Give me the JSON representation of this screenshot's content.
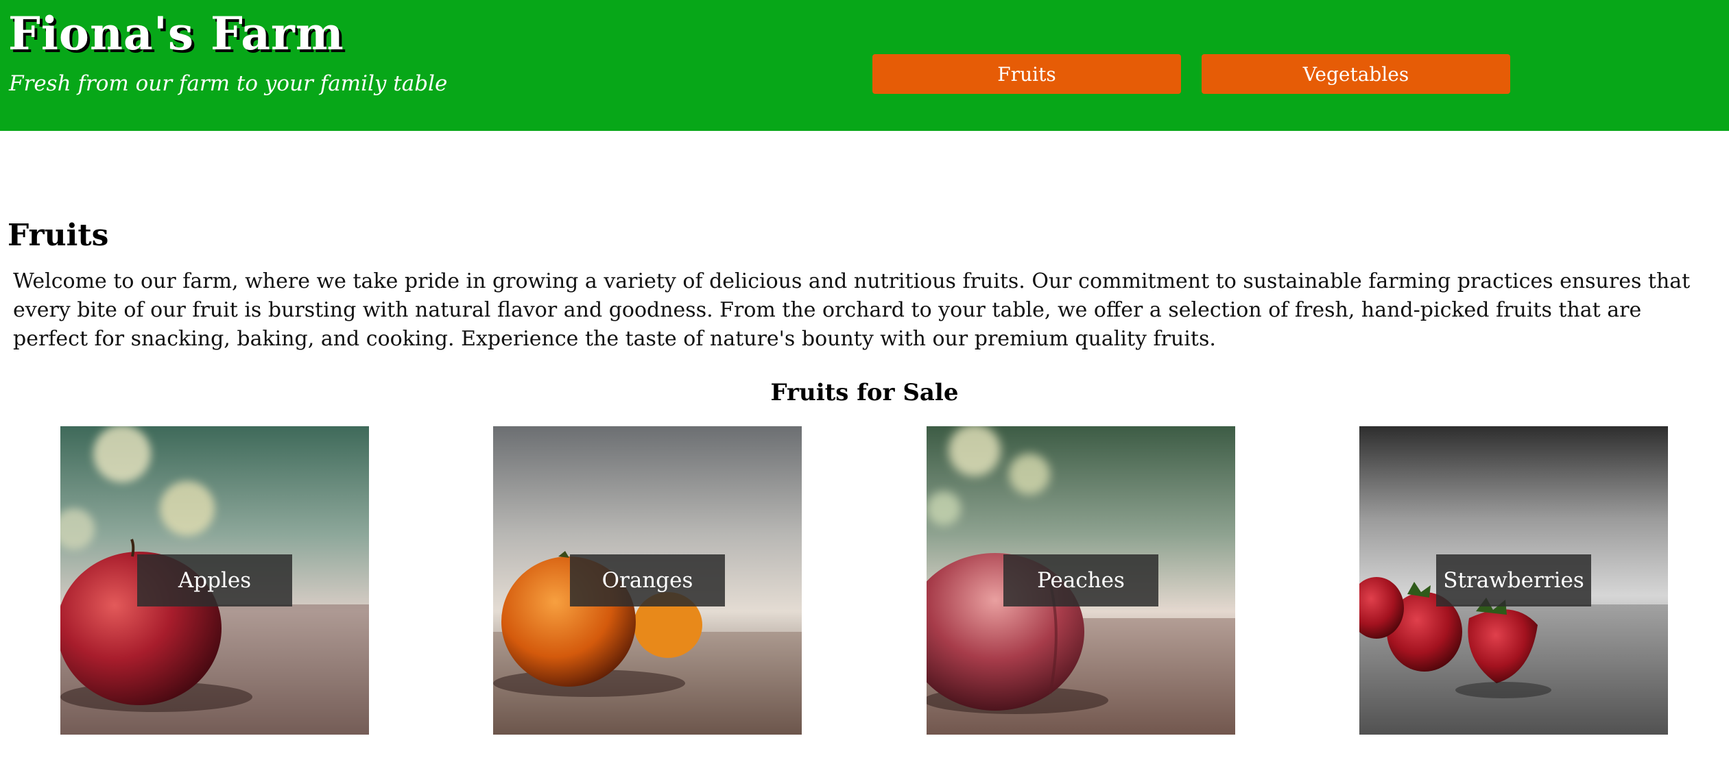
{
  "header": {
    "title": "Fiona's Farm",
    "tagline": "Fresh from our farm to your family table",
    "nav": [
      {
        "label": "Fruits"
      },
      {
        "label": "Vegetables"
      }
    ],
    "colors": {
      "background": "#07a718",
      "nav_button": "#e65c06"
    }
  },
  "main": {
    "section_title": "Fruits",
    "intro": "Welcome to our farm, where we take pride in growing a variety of delicious and nutritious fruits. Our commitment to sustainable farming practices ensures that every bite of our fruit is bursting with natural flavor and goodness. From the orchard to your table, we offer a selection of fresh, hand-picked fruits that are perfect for snacking, baking, and cooking. Experience the taste of nature's bounty with our premium quality fruits.",
    "sale_title": "Fruits for Sale",
    "products": [
      {
        "name": "Apples"
      },
      {
        "name": "Oranges"
      },
      {
        "name": "Peaches"
      },
      {
        "name": "Strawberries"
      }
    ]
  }
}
